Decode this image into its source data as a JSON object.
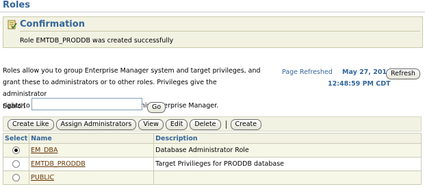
{
  "page": {
    "title": "Roles"
  },
  "confirmation": {
    "title": "Confirmation",
    "message": "Role EMTDB_PRODDB was created successfully"
  },
  "description": {
    "lines": [
      "Roles allow you to group Enterprise Manager system and target privileges, and",
      "grant these to administrators or to other roles. Privileges give the administrator",
      "rights to perform management actions within Enterprise Manager."
    ]
  },
  "refresh": {
    "label": "Page Refreshed",
    "date": "May 27, 2010",
    "time": "12:48:59 PM CDT",
    "button_label": "Refresh"
  },
  "search": {
    "label": "Search",
    "value": "",
    "go_label": "Go"
  },
  "toolbar": {
    "create_like": "Create Like",
    "assign_administrators": "Assign Administrators",
    "view": "View",
    "edit": "Edit",
    "delete": "Delete",
    "create": "Create"
  },
  "table": {
    "headers": {
      "select": "Select",
      "name": "Name",
      "description": "Description"
    },
    "rows": [
      {
        "name": "EM_DBA",
        "description": "Database Administrator Role",
        "selected": true
      },
      {
        "name": "EMTDB_PRODDB",
        "description": "Target Privilieges for PRODDB database",
        "selected": false
      },
      {
        "name": "PUBLIC",
        "description": "",
        "selected": false
      }
    ]
  },
  "colors": {
    "header_blue": "#336699",
    "link_brown": "#663300",
    "panel_bg": "#f2f2e3"
  }
}
